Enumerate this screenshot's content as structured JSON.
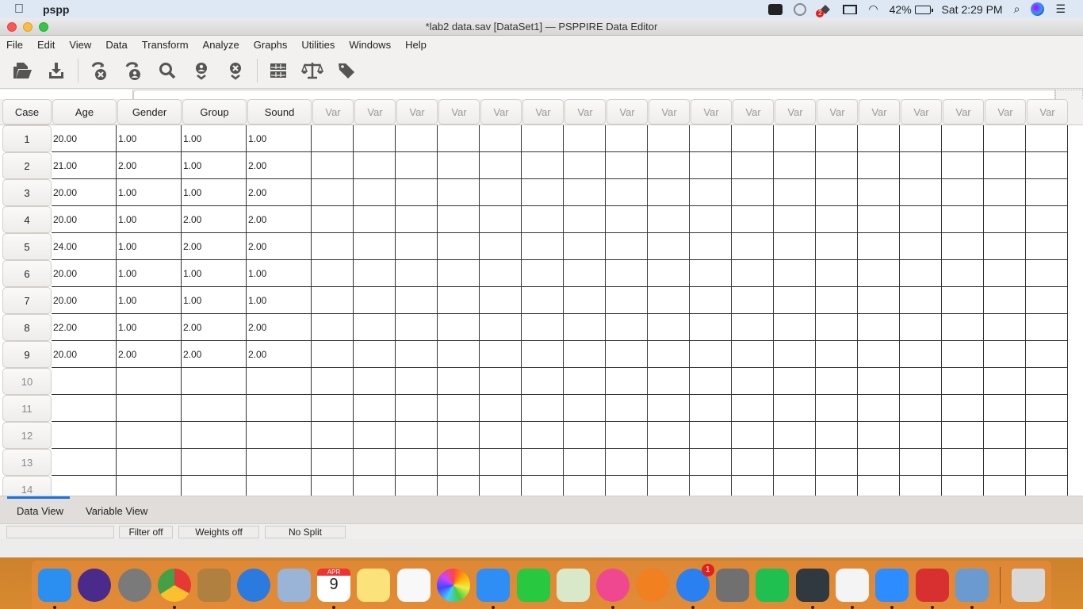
{
  "menubar": {
    "app_name": "pspp",
    "dropbox_badge": "2",
    "battery": "42%",
    "clock": "Sat 2:29 PM"
  },
  "window": {
    "title": "*lab2 data.sav [DataSet1] — PSPPIRE Data Editor"
  },
  "menu": [
    "File",
    "Edit",
    "View",
    "Data",
    "Transform",
    "Analyze",
    "Graphs",
    "Utilities",
    "Windows",
    "Help"
  ],
  "toolbar": {
    "groups": [
      [
        "open-file",
        "save-file"
      ],
      [
        "goto-case",
        "goto-variable",
        "find",
        "insert-case",
        "insert-variable"
      ],
      [
        "split-file",
        "weight-cases",
        "value-labels"
      ]
    ]
  },
  "entry": {
    "cell_ref": "",
    "cell_value": ""
  },
  "grid": {
    "corner_label": "Case",
    "variables": [
      "Age",
      "Gender",
      "Group",
      "Sound"
    ],
    "empty_var_label": "Var",
    "empty_var_count": 18,
    "rows": [
      {
        "case": "1",
        "values": [
          "20.00",
          "1.00",
          "1.00",
          "1.00"
        ]
      },
      {
        "case": "2",
        "values": [
          "21.00",
          "2.00",
          "1.00",
          "2.00"
        ]
      },
      {
        "case": "3",
        "values": [
          "20.00",
          "1.00",
          "1.00",
          "2.00"
        ]
      },
      {
        "case": "4",
        "values": [
          "20.00",
          "1.00",
          "2.00",
          "2.00"
        ]
      },
      {
        "case": "5",
        "values": [
          "24.00",
          "1.00",
          "2.00",
          "2.00"
        ]
      },
      {
        "case": "6",
        "values": [
          "20.00",
          "1.00",
          "1.00",
          "1.00"
        ]
      },
      {
        "case": "7",
        "values": [
          "20.00",
          "1.00",
          "1.00",
          "1.00"
        ]
      },
      {
        "case": "8",
        "values": [
          "22.00",
          "1.00",
          "2.00",
          "2.00"
        ]
      },
      {
        "case": "9",
        "values": [
          "20.00",
          "2.00",
          "2.00",
          "2.00"
        ]
      },
      {
        "case": "10",
        "values": [
          "",
          "",
          "",
          ""
        ]
      },
      {
        "case": "11",
        "values": [
          "",
          "",
          "",
          ""
        ]
      },
      {
        "case": "12",
        "values": [
          "",
          "",
          "",
          ""
        ]
      },
      {
        "case": "13",
        "values": [
          "",
          "",
          "",
          ""
        ]
      },
      {
        "case": "14",
        "values": [
          "",
          "",
          "",
          ""
        ]
      }
    ]
  },
  "tabs": {
    "active": "Data View",
    "items": [
      "Data View",
      "Variable View"
    ]
  },
  "status": {
    "filter": "Filter off",
    "weights": "Weights off",
    "split": "No Split"
  },
  "dock": {
    "items": [
      {
        "name": "finder",
        "color": "#2a8ff0",
        "running": true
      },
      {
        "name": "siri",
        "color": "#4a2a8a",
        "running": false
      },
      {
        "name": "launchpad",
        "color": "#7a7a7a",
        "running": false
      },
      {
        "name": "chrome",
        "color": "#ffffff",
        "running": true
      },
      {
        "name": "contacts",
        "color": "#b08040",
        "running": false
      },
      {
        "name": "safari",
        "color": "#2a7ae0",
        "running": false
      },
      {
        "name": "mail",
        "color": "#9ab4d8",
        "running": false
      },
      {
        "name": "calendar",
        "color": "#ffffff",
        "running": true,
        "label": "9",
        "month": "APR"
      },
      {
        "name": "notes",
        "color": "#fbe27a",
        "running": false
      },
      {
        "name": "reminders",
        "color": "#f8f8f8",
        "running": false
      },
      {
        "name": "photos",
        "color": "#f0f0f0",
        "running": false
      },
      {
        "name": "messages",
        "color": "#2f8ef5",
        "running": true
      },
      {
        "name": "facetime",
        "color": "#28c840",
        "running": false
      },
      {
        "name": "maps",
        "color": "#d8e8c8",
        "running": false
      },
      {
        "name": "itunes",
        "color": "#f04890",
        "running": true
      },
      {
        "name": "books",
        "color": "#f08020",
        "running": false
      },
      {
        "name": "app-store",
        "color": "#2a80f0",
        "running": true,
        "badge": "1"
      },
      {
        "name": "system-preferences",
        "color": "#707070",
        "running": false
      },
      {
        "name": "downloader",
        "color": "#20c050",
        "running": false
      },
      {
        "name": "norton",
        "color": "#303840",
        "running": true
      },
      {
        "name": "textedit",
        "color": "#f4f4f4",
        "running": true
      },
      {
        "name": "zoom",
        "color": "#2d8cff",
        "running": true
      },
      {
        "name": "grapher",
        "color": "#d83030",
        "running": true
      },
      {
        "name": "preview",
        "color": "#6a9ad0",
        "running": true
      }
    ],
    "trash": {
      "name": "trash",
      "color": "#d8d8d8"
    }
  }
}
